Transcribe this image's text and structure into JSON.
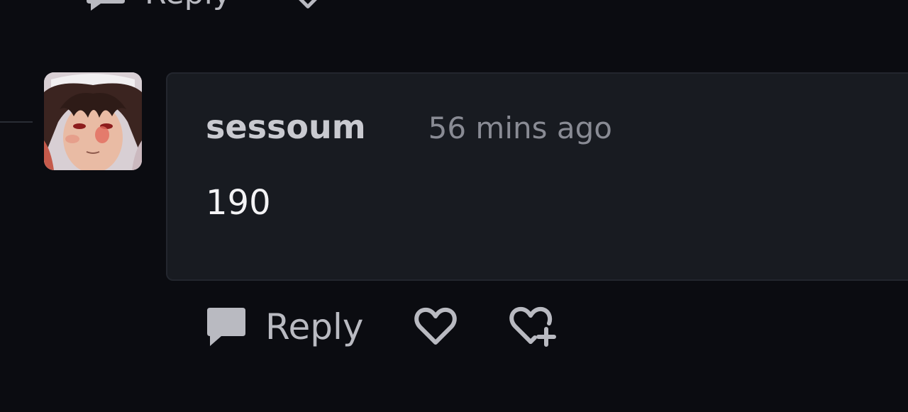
{
  "previous_comment": {
    "reply_label": "Reply",
    "icons": {
      "reply": "speech-bubble-icon",
      "like": "heart-icon"
    }
  },
  "comment": {
    "avatar": "avatar-image",
    "username": "sessoum",
    "timestamp": "56 mins ago",
    "body": "190"
  },
  "actions": {
    "reply_label": "Reply",
    "icons": {
      "reply": "speech-bubble-icon",
      "like": "heart-icon",
      "react": "heart-plus-icon"
    }
  },
  "colors": {
    "background": "#0b0c11",
    "card": "#181b21",
    "card_border": "#23262e",
    "username": "#c9cad0",
    "timestamp": "#898b94",
    "body_text": "#f3f3f5",
    "action": "#b9bac1"
  }
}
